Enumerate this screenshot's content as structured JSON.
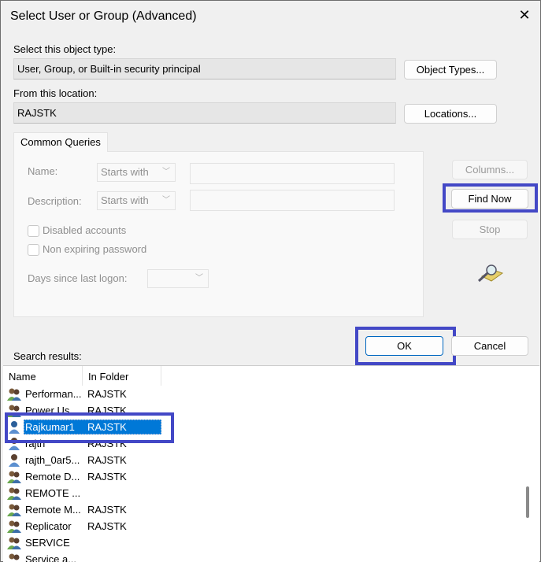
{
  "window": {
    "title": "Select User or Group (Advanced)",
    "close_icon": "close-icon"
  },
  "object_type": {
    "label": "Select this object type:",
    "value": "User, Group, or Built-in security principal",
    "button": "Object Types..."
  },
  "location": {
    "label": "From this location:",
    "value": "RAJSTK",
    "button": "Locations..."
  },
  "queries": {
    "tab": "Common Queries",
    "name_label": "Name:",
    "name_op": "Starts with",
    "description_label": "Description:",
    "description_op": "Starts with",
    "disabled_accounts": "Disabled accounts",
    "non_expiring": "Non expiring password",
    "days_label": "Days since last logon:"
  },
  "side_buttons": {
    "columns": "Columns...",
    "find_now": "Find Now",
    "stop": "Stop"
  },
  "ok": "OK",
  "cancel": "Cancel",
  "results": {
    "label": "Search results:",
    "columns": [
      "Name",
      "In Folder"
    ],
    "rows": [
      {
        "name": "Performan...",
        "folder": "RAJSTK",
        "icon": "group-icon"
      },
      {
        "name": "Power Us",
        "folder": "RAJSTK",
        "icon": "group-icon"
      },
      {
        "name": "Rajkumar1",
        "folder": "RAJSTK",
        "icon": "user-icon",
        "selected": true
      },
      {
        "name": "rajth",
        "folder": "RAJSTK",
        "icon": "user-icon"
      },
      {
        "name": "rajth_0ar5...",
        "folder": "RAJSTK",
        "icon": "user-icon"
      },
      {
        "name": "Remote D...",
        "folder": "RAJSTK",
        "icon": "group-icon"
      },
      {
        "name": "REMOTE ...",
        "folder": "",
        "icon": "group-icon"
      },
      {
        "name": "Remote M...",
        "folder": "RAJSTK",
        "icon": "group-icon"
      },
      {
        "name": "Replicator",
        "folder": "RAJSTK",
        "icon": "group-icon"
      },
      {
        "name": "SERVICE",
        "folder": "",
        "icon": "group-icon"
      },
      {
        "name": "Service a...",
        "folder": "",
        "icon": "group-icon"
      }
    ]
  },
  "colors": {
    "highlight_box": "#4348c6",
    "selection": "#0078d7"
  }
}
